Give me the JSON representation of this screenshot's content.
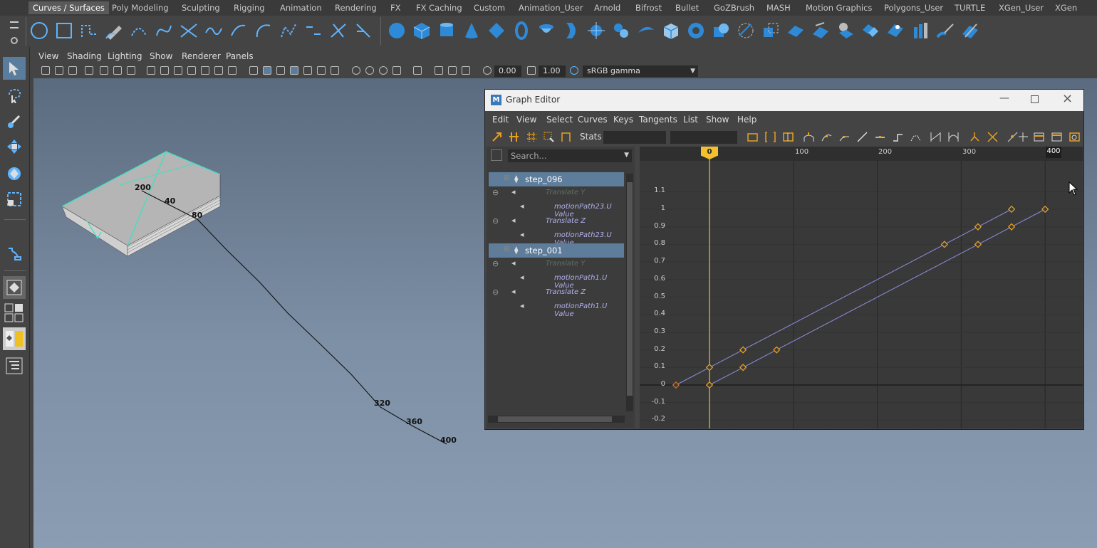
{
  "shelf_tabs": [
    "Curves / Surfaces",
    "Poly Modeling",
    "Sculpting",
    "Rigging",
    "Animation",
    "Rendering",
    "FX",
    "FX Caching",
    "Custom",
    "Animation_User",
    "Arnold",
    "Bifrost",
    "Bullet",
    "GoZBrush",
    "MASH",
    "Motion Graphics",
    "Polygons_User",
    "TURTLE",
    "XGen_User",
    "XGen"
  ],
  "active_shelf": "Curves / Surfaces",
  "panel_menu": [
    "View",
    "Shading",
    "Lighting",
    "Show",
    "Renderer",
    "Panels"
  ],
  "panel_fields": {
    "near": "0.00",
    "far": "1.00",
    "color_space": "sRGB gamma"
  },
  "viewport_labels": [
    "200",
    "40",
    "80",
    "320",
    "360",
    "400"
  ],
  "graph_editor": {
    "title": "Graph Editor",
    "menu": [
      "Edit",
      "View",
      "Select",
      "Curves",
      "Keys",
      "Tangents",
      "List",
      "Show",
      "Help"
    ],
    "stats_label": "Stats",
    "search_placeholder": "Search...",
    "outliner": [
      {
        "label": "step_096",
        "type": "node"
      },
      {
        "label": "Translate Y",
        "type": "attr",
        "dim": true
      },
      {
        "label": "motionPath23.U Value",
        "type": "curve"
      },
      {
        "label": "Translate Z",
        "type": "attr",
        "dim": false
      },
      {
        "label": "motionPath23.U Value",
        "type": "curve"
      },
      {
        "label": "step_001",
        "type": "node"
      },
      {
        "label": "Translate Y",
        "type": "attr",
        "dim": true
      },
      {
        "label": "motionPath1.U Value",
        "type": "curve"
      },
      {
        "label": "Translate Z",
        "type": "attr",
        "dim": false
      },
      {
        "label": "motionPath1.U Value",
        "type": "curve"
      }
    ],
    "time_ticks": [
      "100",
      "200",
      "300"
    ],
    "current_frame": "0",
    "end_frame": "400",
    "y_ticks": [
      "1.1",
      "1",
      "0.9",
      "0.8",
      "0.7",
      "0.6",
      "0.5",
      "0.4",
      "0.3",
      "0.2",
      "0.1",
      "0",
      "-0.1",
      "-0.2"
    ],
    "curve_color": "#8e8ee0",
    "key_color": "#e8a020",
    "current_time_color": "#f2c12e"
  },
  "colors": {
    "active_tab": "#5a5a5a",
    "selection": "#5e7d9b",
    "shelf_bg": "#444444"
  }
}
